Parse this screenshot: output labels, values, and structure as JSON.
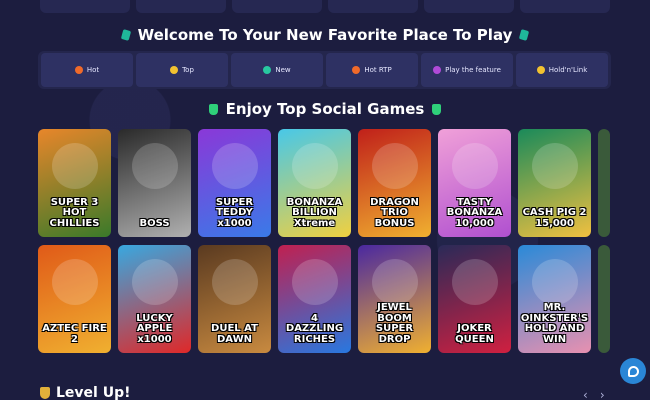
{
  "welcome": {
    "title": "Welcome To Your New Favorite Place To Play"
  },
  "filters": [
    {
      "label": "Hot",
      "icon": "fire-icon",
      "color": "#f06a2a"
    },
    {
      "label": "Top",
      "icon": "coin-icon",
      "color": "#f2c230"
    },
    {
      "label": "New",
      "icon": "sparkle-icon",
      "color": "#28c8a0"
    },
    {
      "label": "Hot RTP",
      "icon": "fire-icon",
      "color": "#f06a2a"
    },
    {
      "label": "Play the feature",
      "icon": "star-icon",
      "color": "#b04ad8"
    },
    {
      "label": "Hold'n'Link",
      "icon": "trophy-icon",
      "color": "#f2c230"
    }
  ],
  "section": {
    "title": "Enjoy Top Social Games"
  },
  "games_row1": [
    {
      "label": "SUPER 3 HOT CHILLIES",
      "bg": "#e8862a",
      "bg2": "#3a7a2a"
    },
    {
      "label": "BOSS",
      "bg": "#2a2a2a",
      "bg2": "#b0b0b0"
    },
    {
      "label": "SUPER TEDDY x1000",
      "bg": "#8a38d8",
      "bg2": "#3a7ae8"
    },
    {
      "label": "BONANZA BILLION Xtreme",
      "bg": "#48c8e8",
      "bg2": "#f0d040"
    },
    {
      "label": "DRAGON TRIO BONUS",
      "bg": "#c0201a",
      "bg2": "#f0b030"
    },
    {
      "label": "TASTY BONANZA 10,000",
      "bg": "#f0a0d8",
      "bg2": "#b050d0"
    },
    {
      "label": "CASH PIG 2 15,000",
      "bg": "#1a8a5a",
      "bg2": "#f0c040"
    }
  ],
  "games_row2": [
    {
      "label": "AZTEC FIRE 2",
      "bg": "#e05a18",
      "bg2": "#f0b030"
    },
    {
      "label": "LUCKY APPLE x1000",
      "bg": "#38a8e0",
      "bg2": "#e02828"
    },
    {
      "label": "DUEL AT DAWN",
      "bg": "#5a3a20",
      "bg2": "#c88a40"
    },
    {
      "label": "4 DAZZLING RICHES",
      "bg": "#c02050",
      "bg2": "#2878e0"
    },
    {
      "label": "JEWEL BOOM SUPER DROP",
      "bg": "#4a28a0",
      "bg2": "#f0b030"
    },
    {
      "label": "JOKER QUEEN",
      "bg": "#2a2a58",
      "bg2": "#d02040"
    },
    {
      "label": "MR. OINKSTER'S HOLD AND WIN",
      "bg": "#2a8ad8",
      "bg2": "#e890b0"
    }
  ],
  "levelup": {
    "title": "Level Up!"
  },
  "nav": {
    "prev": "‹",
    "next": "›"
  }
}
